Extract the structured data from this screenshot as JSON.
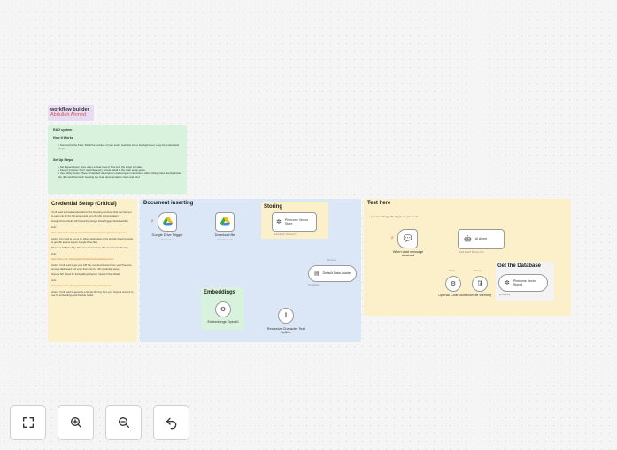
{
  "title_note": {
    "title": "workflow builder",
    "author": "Abdullah Ahmed"
  },
  "rag_note": {
    "heading": "RAG system",
    "how_title": "How It Works",
    "how_items": [
      "• Summarize the Flow: Distill the function of your entire workflow into a few high-level, easy-for-understand steps."
    ],
    "setup_title": "Set Up Steps",
    "setup_items": [
      "• Set Expectations: Give users a clear idea of how long the setup will take.",
      "• Keep it Concise: Don't describe every minute detail in the main setup guide.",
      "• Use Sticky Notes: Place all detailed descriptions and complex instructions within sticky notes directly inside the n8n workflow itself, keeping the main documentation clean and brief."
    ]
  },
  "credential_note": {
    "heading": "Credential Setup (Critical)",
    "blocks": [
      {
        "type": "p",
        "text": "You'll need to create credentials for the following services. Click the link next to each one for the full setup guide from the n8n documentation."
      },
      {
        "type": "p",
        "text": "Google Drive OAuth2 API (Used by: Google Drive Trigger, Download file)"
      },
      {
        "type": "p",
        "text": "Link:"
      },
      {
        "type": "link",
        "text": "https://docs.n8n.io/integrations/builtin/credentials/google/oauth-generic/"
      },
      {
        "type": "p",
        "text": "Action: You need to set up an OAuth application in the Google Cloud Console to get n8n access to your Google Drive files."
      },
      {
        "type": "p",
        "text": "Pinecone API (Used by: Pinecone Vector Store, Pinecone Vector Store1)"
      },
      {
        "type": "p",
        "text": "Link:"
      },
      {
        "type": "link",
        "text": "https://docs.n8n.io/integrations/builtin/credentials/pinecone/"
      },
      {
        "type": "p",
        "text": "Action: You'll need to get your API Key and Environment from your Pinecone account dashboard and enter them into the n8n credential setup."
      },
      {
        "type": "p",
        "text": "OpenAI API (Used by: Embeddings OpenAI, OpenAI Chat Model)"
      },
      {
        "type": "p",
        "text": "Link:"
      },
      {
        "type": "link",
        "text": "https://docs.n8n.io/integrations/builtin/credentials/openai/"
      },
      {
        "type": "p",
        "text": "Action: You'll need to generate a Secret API Key from your OpenAI account to use for embeddings and the chat model."
      }
    ]
  },
  "groups": {
    "document_inserting": "Document inserting",
    "storing": "Storing",
    "embeddings": "Embeddings",
    "test_here": "Test here",
    "test_note": "• you can change the trigger as you need",
    "get_database": "Get the Database"
  },
  "nodes": {
    "gdrive_trigger": {
      "label": "Google Drive Trigger",
      "sub": "fileCreated"
    },
    "download_file": {
      "label": "Download file",
      "sub": "download: file"
    },
    "pinecone_store": {
      "label": "Pinecone Vector Store",
      "port": "Embedding*  Document*"
    },
    "default_loader": {
      "label": "Default Data Loader",
      "port_top": "Document",
      "port_bottom": "Text Splitter"
    },
    "embeddings_openai": {
      "label": "Embeddings OpenAI"
    },
    "text_splitter": {
      "label": "Recursive Character Text Splitter"
    },
    "chat_trigger": {
      "label": "When chat message received"
    },
    "ai_agent": {
      "label": "AI Agent",
      "ports": "Chat Model*   Memory   Tool"
    },
    "openai_chat": {
      "label": "OpenAI Chat Model",
      "port": "Model"
    },
    "simple_memory": {
      "label": "Simple Memory",
      "port": "Memory"
    },
    "pinecone_store1": {
      "label": "Pinecone Vector Store1",
      "port": "Embedding"
    }
  },
  "controls": {
    "fit_view": "fit-view",
    "zoom_in": "zoom-in",
    "zoom_out": "zoom-out",
    "undo": "undo"
  },
  "colors": {
    "purple_note": "#e7dcf4",
    "green_note": "#d9f2de",
    "yellow_note": "#fbf0c9",
    "blue_group": "#dbe7f6",
    "edge": "#9a9a9a",
    "trigger_bolt": "#e35a5a"
  }
}
